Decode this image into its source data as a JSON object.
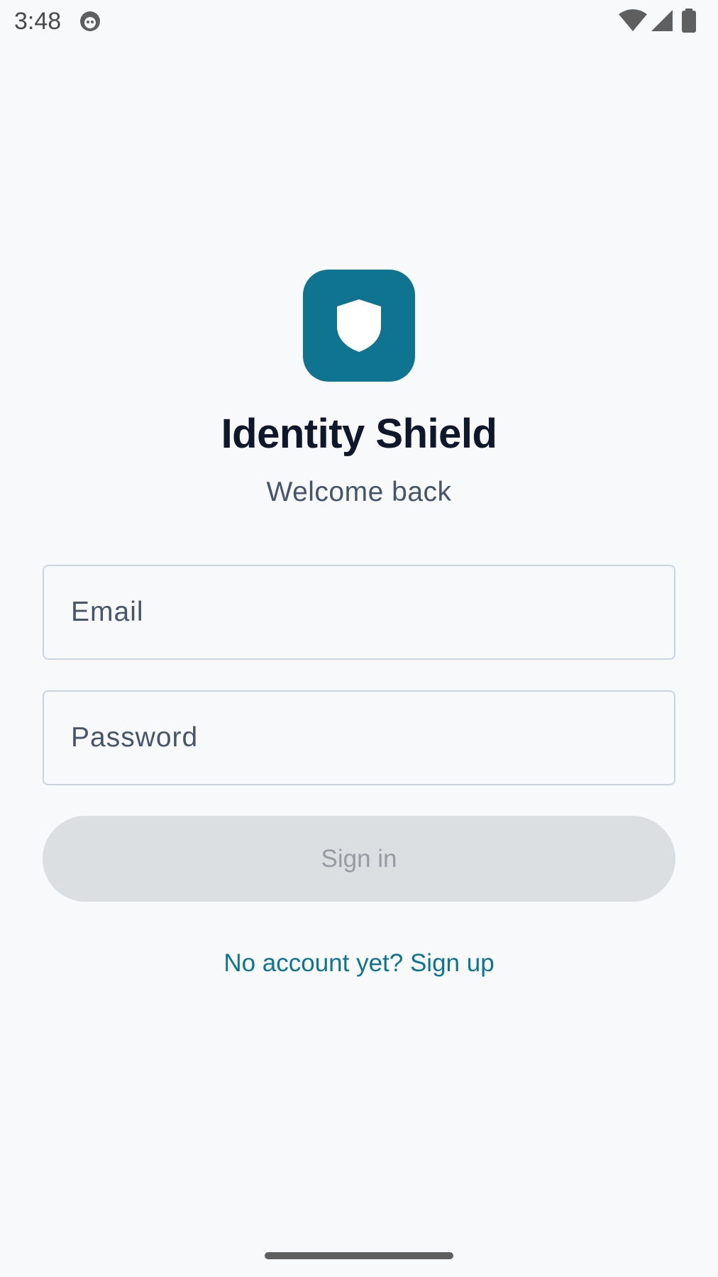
{
  "status_bar": {
    "time": "3:48",
    "icons": [
      "app-notification-icon",
      "wifi-icon",
      "cellular-signal-icon",
      "battery-icon"
    ]
  },
  "app": {
    "logo_icon": "shield-icon",
    "brand_color": "#0e7490",
    "title": "Identity Shield",
    "subtitle": "Welcome back"
  },
  "form": {
    "email": {
      "placeholder": "Email",
      "value": ""
    },
    "password": {
      "placeholder": "Password",
      "value": ""
    },
    "submit_label": "Sign in",
    "submit_state": "disabled"
  },
  "footer": {
    "signup_link": "No account yet? Sign up"
  }
}
